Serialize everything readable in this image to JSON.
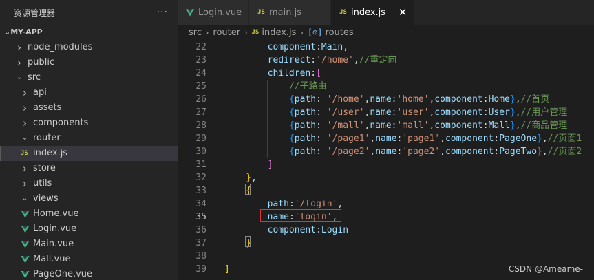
{
  "sidebar": {
    "title": "资源管理器",
    "more": "···",
    "project": "MY-APP",
    "items": [
      {
        "label": "node_modules",
        "type": "folder"
      },
      {
        "label": "public",
        "type": "folder"
      },
      {
        "label": "src",
        "type": "folder-open"
      },
      {
        "label": "api",
        "type": "folder"
      },
      {
        "label": "assets",
        "type": "folder"
      },
      {
        "label": "components",
        "type": "folder"
      },
      {
        "label": "router",
        "type": "folder-open"
      },
      {
        "label": "index.js",
        "type": "js"
      },
      {
        "label": "store",
        "type": "folder"
      },
      {
        "label": "utils",
        "type": "folder"
      },
      {
        "label": "views",
        "type": "folder-open"
      },
      {
        "label": "Home.vue",
        "type": "vue"
      },
      {
        "label": "Login.vue",
        "type": "vue"
      },
      {
        "label": "Main.vue",
        "type": "vue"
      },
      {
        "label": "Mall.vue",
        "type": "vue"
      },
      {
        "label": "PageOne.vue",
        "type": "vue"
      }
    ]
  },
  "tabs": [
    {
      "label": "Login.vue",
      "icon": "vue-icon",
      "active": false
    },
    {
      "label": "main.js",
      "icon": "js",
      "active": false
    },
    {
      "label": "index.js",
      "icon": "js",
      "active": true,
      "close": "✕"
    }
  ],
  "breadcrumb": {
    "parts": [
      "src",
      "router",
      "index.js",
      "routes"
    ],
    "js_badge": "JS",
    "symbol_icon": "[⊙]"
  },
  "js_badge": "JS",
  "editor": {
    "current_line": 35,
    "lines": [
      {
        "n": "22",
        "text": "        component:Main,"
      },
      {
        "n": "23",
        "text": "        redirect:'/home',//重定向"
      },
      {
        "n": "24",
        "text": "        children:["
      },
      {
        "n": "25",
        "text": "            //子路由"
      },
      {
        "n": "26",
        "text": "            {path: '/home',name:'home',component:Home},//首页"
      },
      {
        "n": "27",
        "text": "            {path: '/user',name:'user',component:User},//用户管理"
      },
      {
        "n": "28",
        "text": "            {path: '/mall',name:'mall',component:Mall},//商品管理"
      },
      {
        "n": "29",
        "text": "            {path: '/page1',name:'page1',component:PageOne},//页面1"
      },
      {
        "n": "30",
        "text": "            {path: '/page2',name:'page2',component:PageTwo},//页面2"
      },
      {
        "n": "31",
        "text": "        ]"
      },
      {
        "n": "32",
        "text": "    },"
      },
      {
        "n": "33",
        "text": "    {"
      },
      {
        "n": "34",
        "text": "        path:'/login',"
      },
      {
        "n": "35",
        "text": "        name:'login',"
      },
      {
        "n": "36",
        "text": "        component:Login"
      },
      {
        "n": "37",
        "text": "    }"
      },
      {
        "n": "38",
        "text": ""
      },
      {
        "n": "39",
        "text": "]"
      }
    ]
  },
  "watermark": "CSDN @Ameame-",
  "colors": {
    "vue_green": "#41b883",
    "js_yellow": "#cbcb41",
    "highlight_box": "#e03434"
  }
}
